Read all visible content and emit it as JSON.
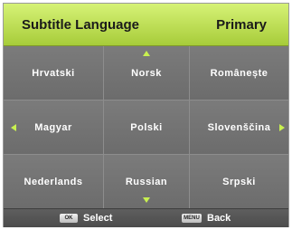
{
  "header": {
    "title": "Subtitle Language",
    "value": "Primary"
  },
  "languages": [
    [
      "Hrvatski",
      "Norsk",
      "Românește"
    ],
    [
      "Magyar",
      "Polski",
      "Slovenščina"
    ],
    [
      "Nederlands",
      "Russian",
      "Srpski"
    ]
  ],
  "footer": {
    "ok_key": "OK",
    "select_label": "Select",
    "menu_key": "MENU",
    "back_label": "Back"
  },
  "colors": {
    "header_top": "#d6f276",
    "header_bottom": "#a7cc3a",
    "arrow": "#c8f050",
    "panel": "#6a6a6a"
  }
}
